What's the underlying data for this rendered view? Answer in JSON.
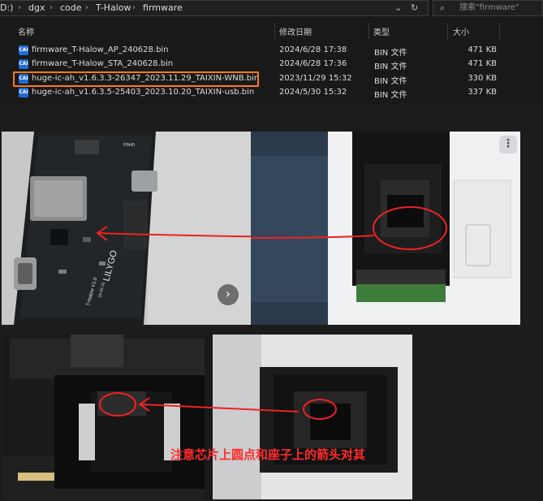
{
  "addressbar": {
    "drive": "D:)",
    "path": [
      "dgx",
      "code",
      "T-Halow",
      "firmware"
    ]
  },
  "search": {
    "placeholder": "搜索\"firmware\""
  },
  "columns": {
    "name": "名称",
    "modified": "修改日期",
    "type": "类型",
    "size": "大小"
  },
  "files": [
    {
      "name": "firmware_T-Halow_AP_240628.bin",
      "modified": "2024/6/28 17:38",
      "type": "BIN 文件",
      "size": "471 KB",
      "icon": "bin-file-icon"
    },
    {
      "name": "firmware_T-Halow_STA_240628.bin",
      "modified": "2024/6/28 17:36",
      "type": "BIN 文件",
      "size": "471 KB",
      "icon": "bin-file-icon"
    },
    {
      "name": "huge-ic-ah_v1.6.3.3-26347_2023.11.29_TAIXIN-WNB.bin",
      "modified": "2023/11/29 15:32",
      "type": "BIN 文件",
      "size": "330 KB",
      "icon": "bin-file-icon",
      "highlighted": true
    },
    {
      "name": "huge-ic-ah_v1.6.3.5-25403_2023.10.20_TAIXIN-usb.bin",
      "modified": "2024/5/30 15:32",
      "type": "BIN 文件",
      "size": "337 KB",
      "icon": "bin-file-icon"
    }
  ],
  "file_icon_label": "CAI",
  "photos": {
    "board": {
      "silkscreen": [
        "LILYGO",
        "T-Halow V1.0",
        "24-05-31",
        "PIN45"
      ]
    },
    "annotation": "注意芯片上圆点和座子上的箭头对其"
  },
  "colors": {
    "highlight": "#ff7a1a",
    "annotation": "#ff2b2b",
    "icon": "#1e6bd6"
  }
}
